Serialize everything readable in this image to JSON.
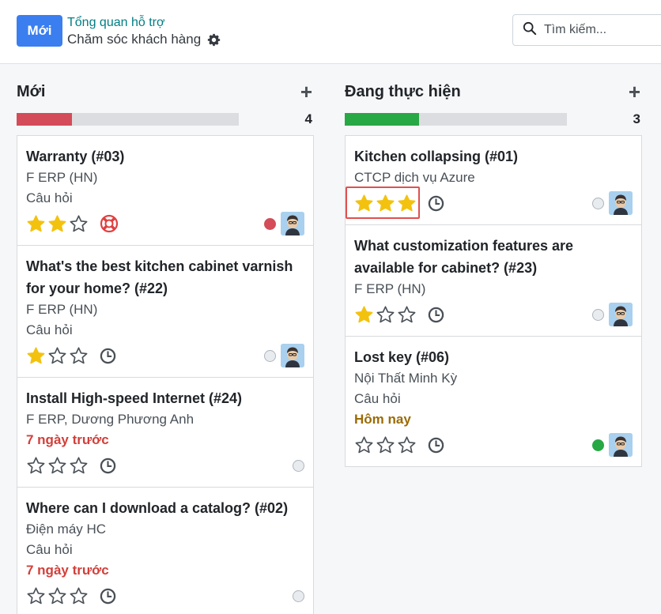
{
  "header": {
    "new_button": "Mới",
    "breadcrumb": "Tổng quan hỗ trợ",
    "page_title": "Chăm sóc khách hàng",
    "search_placeholder": "Tìm kiếm..."
  },
  "colors": {
    "primary": "#3a7ef0",
    "teal": "#017e84",
    "progress_red": "#d44c59",
    "progress_green": "#28a745",
    "star_gold": "#f3c20e",
    "deadline_red": "#d23f3a",
    "deadline_gold": "#9a6b06"
  },
  "columns": [
    {
      "title": "Mới",
      "count": "4",
      "progress_color": "#d44c59",
      "progress_fraction": 0.25,
      "cards": [
        {
          "title": "Warranty (#03)",
          "lines": [
            {
              "text": "F ERP (HN)",
              "style": ""
            },
            {
              "text": "Câu hỏi",
              "style": ""
            }
          ],
          "stars": 2,
          "icon": "lifebuoy",
          "status": "red"
        },
        {
          "title": "What's the best kitchen cabinet varnish for your home? (#22)",
          "lines": [
            {
              "text": "F ERP (HN)",
              "style": ""
            },
            {
              "text": "Câu hỏi",
              "style": ""
            }
          ],
          "stars": 1,
          "icon": "clock",
          "status": "none"
        },
        {
          "title": "Install High-speed Internet (#24)",
          "lines": [
            {
              "text": "F ERP, Dương Phương Anh",
              "style": ""
            },
            {
              "text": "7 ngày trước",
              "style": "red"
            }
          ],
          "stars": 0,
          "icon": "clock",
          "status": "none",
          "no_avatar": true
        },
        {
          "title": "Where can I download a catalog? (#02)",
          "lines": [
            {
              "text": "Điện máy HC",
              "style": ""
            },
            {
              "text": "Câu hỏi",
              "style": ""
            },
            {
              "text": "7 ngày trước",
              "style": "red"
            }
          ],
          "stars": 0,
          "icon": "clock",
          "status": "none",
          "no_avatar": true
        }
      ]
    },
    {
      "title": "Đang thực hiện",
      "count": "3",
      "progress_color": "#28a745",
      "progress_fraction": 0.333,
      "cards": [
        {
          "title": "Kitchen collapsing (#01)",
          "lines": [
            {
              "text": "CTCP dịch vụ Azure",
              "style": ""
            }
          ],
          "stars": 3,
          "icon": "clock",
          "status": "none"
        },
        {
          "title": "What customization features are available for cabinet? (#23)",
          "lines": [
            {
              "text": "F ERP (HN)",
              "style": ""
            }
          ],
          "stars": 1,
          "icon": "clock",
          "status": "none"
        },
        {
          "title": "Lost key (#06)",
          "lines": [
            {
              "text": "Nội Thất Minh Kỳ",
              "style": ""
            },
            {
              "text": "Câu hỏi",
              "style": ""
            },
            {
              "text": "Hôm nay",
              "style": "gold"
            }
          ],
          "stars": 0,
          "icon": "clock",
          "status": "green"
        }
      ]
    }
  ]
}
